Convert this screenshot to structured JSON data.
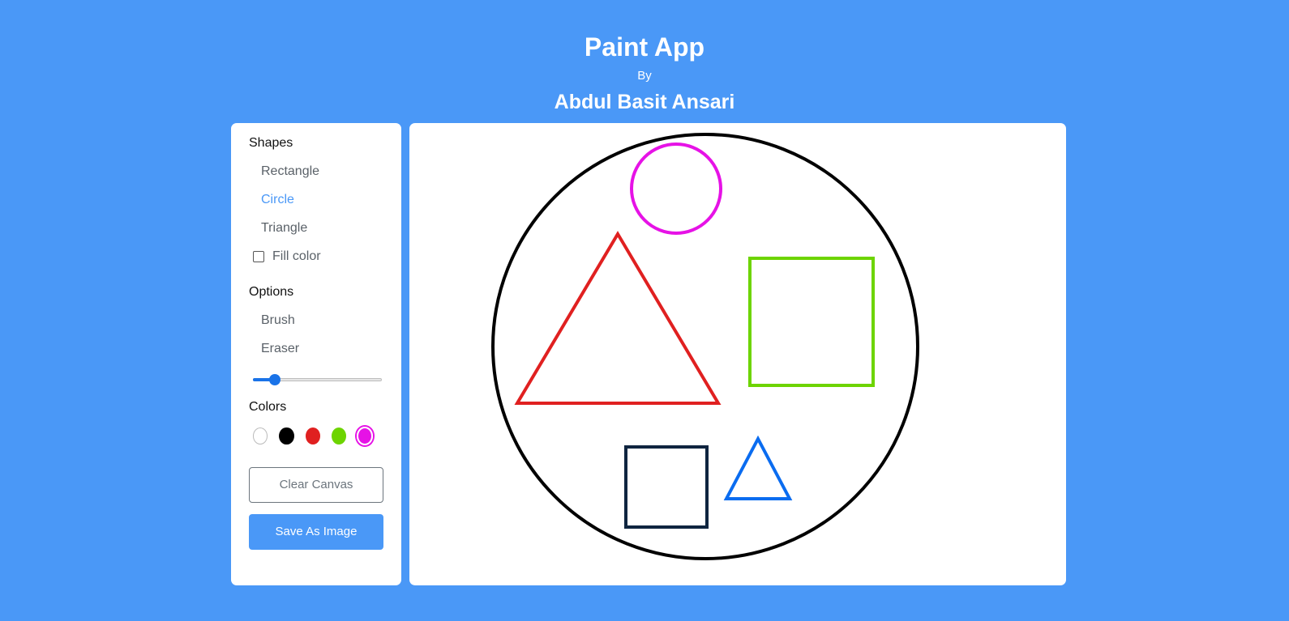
{
  "header": {
    "title": "Paint App",
    "by": "By",
    "author": "Abdul Basit Ansari"
  },
  "toolbox": {
    "shapes": {
      "title": "Shapes",
      "items": [
        {
          "label": "Rectangle",
          "active": false
        },
        {
          "label": "Circle",
          "active": true
        },
        {
          "label": "Triangle",
          "active": false
        }
      ],
      "fill_color_label": "Fill color",
      "fill_color_checked": false
    },
    "options": {
      "title": "Options",
      "items": [
        {
          "label": "Brush"
        },
        {
          "label": "Eraser"
        }
      ],
      "brush_size_fraction": 0.17
    },
    "colors": {
      "title": "Colors",
      "swatches": [
        "#ffffff",
        "#000000",
        "#e02020",
        "#6dd400",
        "#e612e6"
      ],
      "selected": "#e612e6"
    },
    "buttons": {
      "clear": "Clear Canvas",
      "save": "Save As Image"
    }
  },
  "canvas": {
    "shapes": [
      {
        "type": "circle",
        "color": "#000000"
      },
      {
        "type": "circle",
        "color": "#e612e6"
      },
      {
        "type": "triangle",
        "color": "#e02020"
      },
      {
        "type": "rectangle",
        "color": "#6dd400"
      },
      {
        "type": "rectangle",
        "color": "#0f2540"
      },
      {
        "type": "triangle",
        "color": "#0a6cf0"
      }
    ]
  }
}
